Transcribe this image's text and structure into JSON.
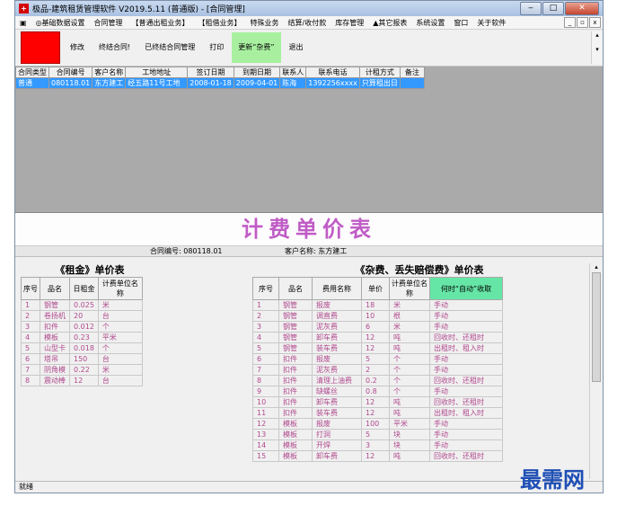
{
  "window": {
    "title": "极品-建筑租赁管理软件 V2019.5.11 (普通版) - [合同管理]",
    "btn_min": "‒",
    "btn_max": "□",
    "btn_close": "✕"
  },
  "menu": [
    "◎基础数据设置",
    "合同管理",
    "【普通出租业务】",
    "【租借业务】",
    "特殊业务",
    "结算/收付款",
    "库存管理",
    "▲其它报表",
    "系统设置",
    "窗口",
    "关于软件"
  ],
  "mdi": {
    "min": "_",
    "max": "▫",
    "close": "x"
  },
  "toolbar": {
    "items": [
      "修改",
      "终结合同!",
      "已终结合同管理",
      "打印",
      "更新“杂费”",
      "退出"
    ]
  },
  "grid": {
    "headers": [
      "合同类型",
      "合同编号",
      "客户名称",
      "工地地址",
      "签订日期",
      "到期日期",
      "联系人",
      "联系电话",
      "计租方式",
      "备注"
    ],
    "row": [
      "普通",
      "080118.01",
      "东方建工",
      "经五路11号工地",
      "2008-01-18",
      "2009-04-01",
      "陈海",
      "1392256xxxx",
      "只算租出日",
      ""
    ]
  },
  "price_title": "计费单价表",
  "info": {
    "contract": "合同编号: 080118.01",
    "customer": "客户名称: 东方建工"
  },
  "rent": {
    "title": "《租金》单价表",
    "headers": [
      "序号",
      "品名",
      "日租金",
      "计费单位名称"
    ],
    "rows": [
      [
        "1",
        "钢管",
        "0.025",
        "米"
      ],
      [
        "2",
        "卷扬机",
        "20",
        "台"
      ],
      [
        "3",
        "扣件",
        "0.012",
        "个"
      ],
      [
        "4",
        "模板",
        "0.23",
        "平米"
      ],
      [
        "5",
        "山型卡",
        "0.018",
        "个"
      ],
      [
        "6",
        "塔吊",
        "150",
        "台"
      ],
      [
        "7",
        "阴角模",
        "0.22",
        "米"
      ],
      [
        "8",
        "震动棒",
        "12",
        "台"
      ]
    ]
  },
  "misc": {
    "title": "《杂费、丢失赔偿费》单价表",
    "headers": [
      "序号",
      "品名",
      "费用名称",
      "单价",
      "计费单位名称",
      "何时“自动”收取"
    ],
    "rows": [
      [
        "1",
        "钢管",
        "报废",
        "18",
        "米",
        "手动"
      ],
      [
        "2",
        "钢管",
        "调直费",
        "10",
        "根",
        "手动"
      ],
      [
        "3",
        "钢管",
        "泥灰费",
        "6",
        "米",
        "手动"
      ],
      [
        "4",
        "钢管",
        "卸车费",
        "12",
        "吨",
        "回收时、还租时"
      ],
      [
        "5",
        "钢管",
        "装车费",
        "12",
        "吨",
        "出租时、租入时"
      ],
      [
        "6",
        "扣件",
        "报废",
        "5",
        "个",
        "手动"
      ],
      [
        "7",
        "扣件",
        "泥灰费",
        "2",
        "个",
        "手动"
      ],
      [
        "8",
        "扣件",
        "清理上油费",
        "0.2",
        "个",
        "回收时、还租时"
      ],
      [
        "9",
        "扣件",
        "缺螺丝",
        "0.8",
        "个",
        "手动"
      ],
      [
        "10",
        "扣件",
        "卸车费",
        "12",
        "吨",
        "回收时、还租时"
      ],
      [
        "11",
        "扣件",
        "装车费",
        "12",
        "吨",
        "出租时、租入时"
      ],
      [
        "12",
        "模板",
        "报废",
        "100",
        "平米",
        "手动"
      ],
      [
        "13",
        "模板",
        "打洞",
        "5",
        "块",
        "手动"
      ],
      [
        "14",
        "模板",
        "开焊",
        "3",
        "块",
        "手动"
      ],
      [
        "15",
        "模板",
        "卸车费",
        "12",
        "吨",
        "回收时、还租时"
      ]
    ]
  },
  "status": "就绪",
  "watermark": "最需网"
}
